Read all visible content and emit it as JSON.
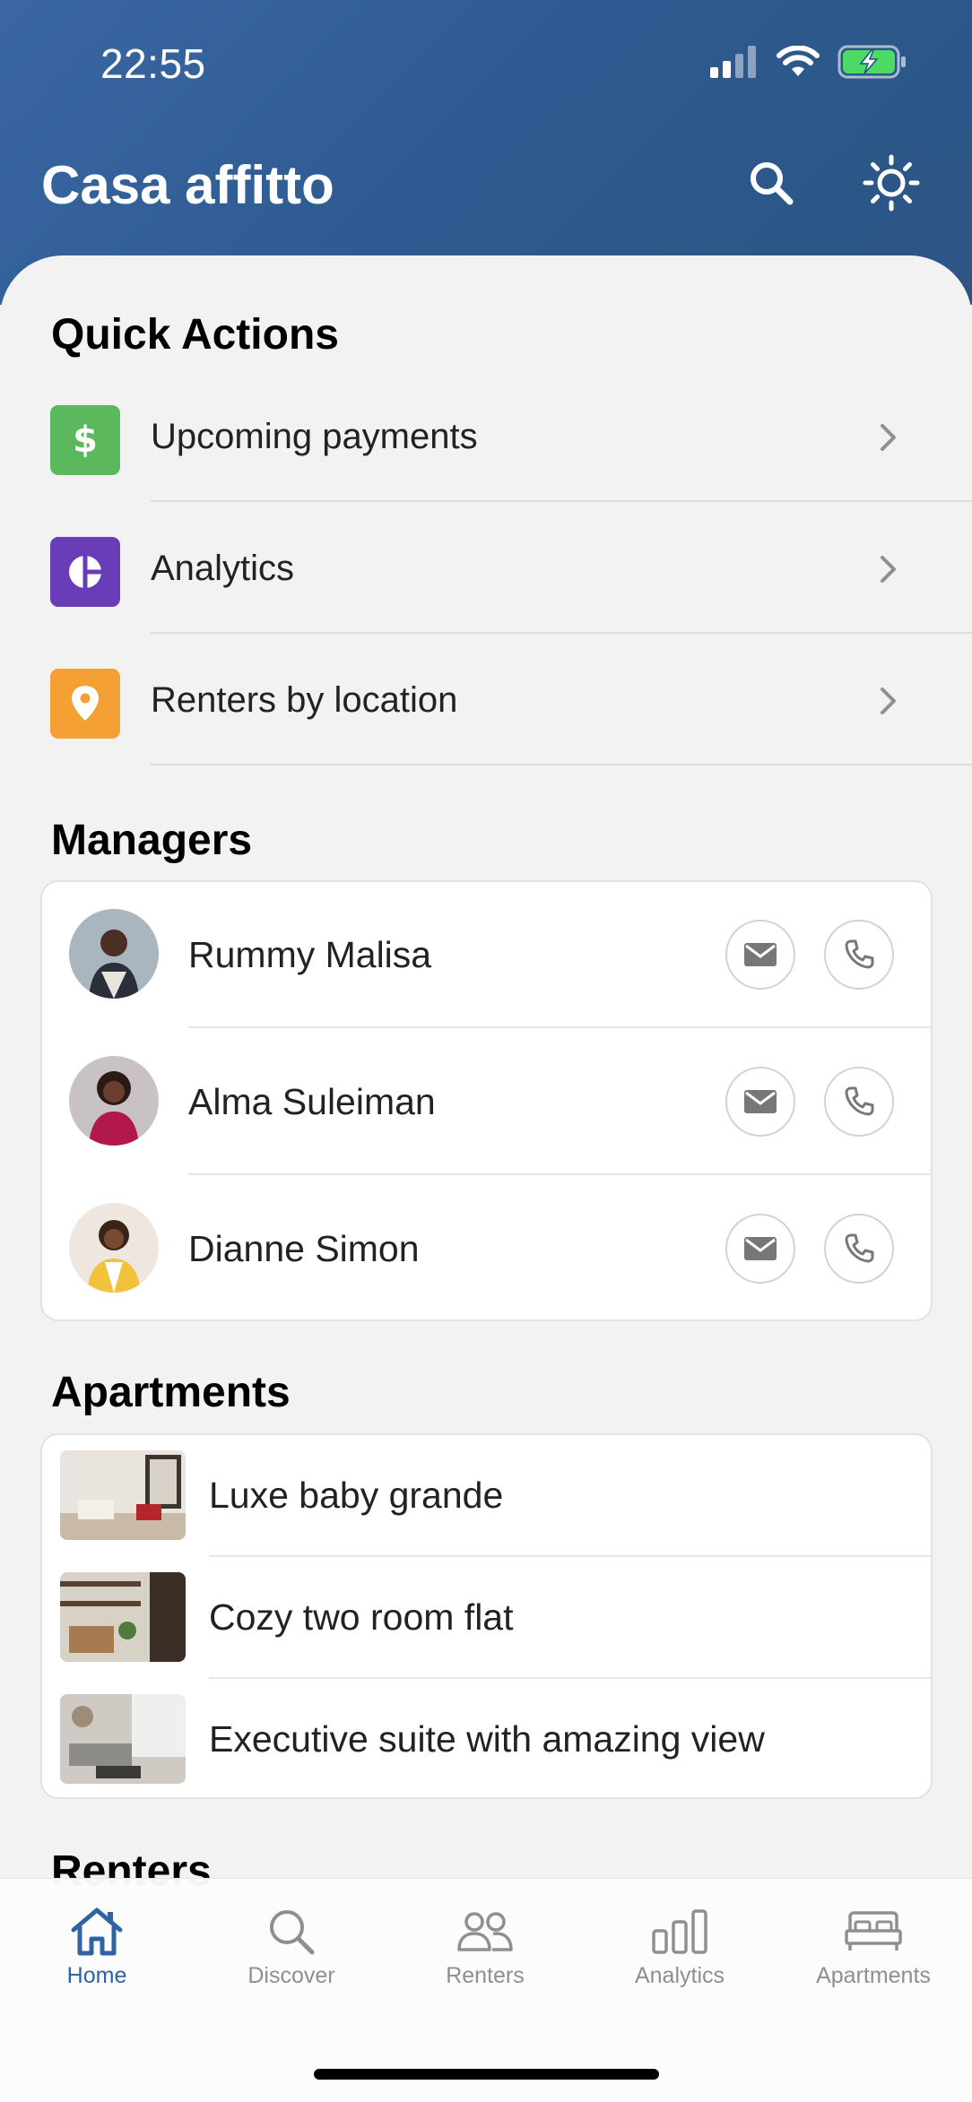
{
  "status_bar": {
    "time": "22:55"
  },
  "header": {
    "title": "Casa affitto"
  },
  "quick_actions": {
    "title": "Quick Actions",
    "items": [
      {
        "label": "Upcoming payments",
        "icon": "dollar-icon",
        "color": "#5cb85c"
      },
      {
        "label": "Analytics",
        "icon": "pie-chart-icon",
        "color": "#6a3db8"
      },
      {
        "label": "Renters by location",
        "icon": "location-pin-icon",
        "color": "#f4a034"
      }
    ]
  },
  "managers": {
    "title": "Managers",
    "items": [
      {
        "name": "Rummy Malisa"
      },
      {
        "name": "Alma Suleiman"
      },
      {
        "name": "Dianne Simon"
      }
    ]
  },
  "apartments": {
    "title": "Apartments",
    "items": [
      {
        "name": "Luxe baby grande"
      },
      {
        "name": "Cozy two room flat"
      },
      {
        "name": "Executive suite with amazing view"
      }
    ]
  },
  "renters": {
    "title": "Renters"
  },
  "tabbar": {
    "tabs": [
      {
        "label": "Home",
        "active": true
      },
      {
        "label": "Discover",
        "active": false
      },
      {
        "label": "Renters",
        "active": false
      },
      {
        "label": "Analytics",
        "active": false
      },
      {
        "label": "Apartments",
        "active": false
      }
    ]
  },
  "colors": {
    "accent": "#2f63a3",
    "header": "#2d5a90"
  }
}
